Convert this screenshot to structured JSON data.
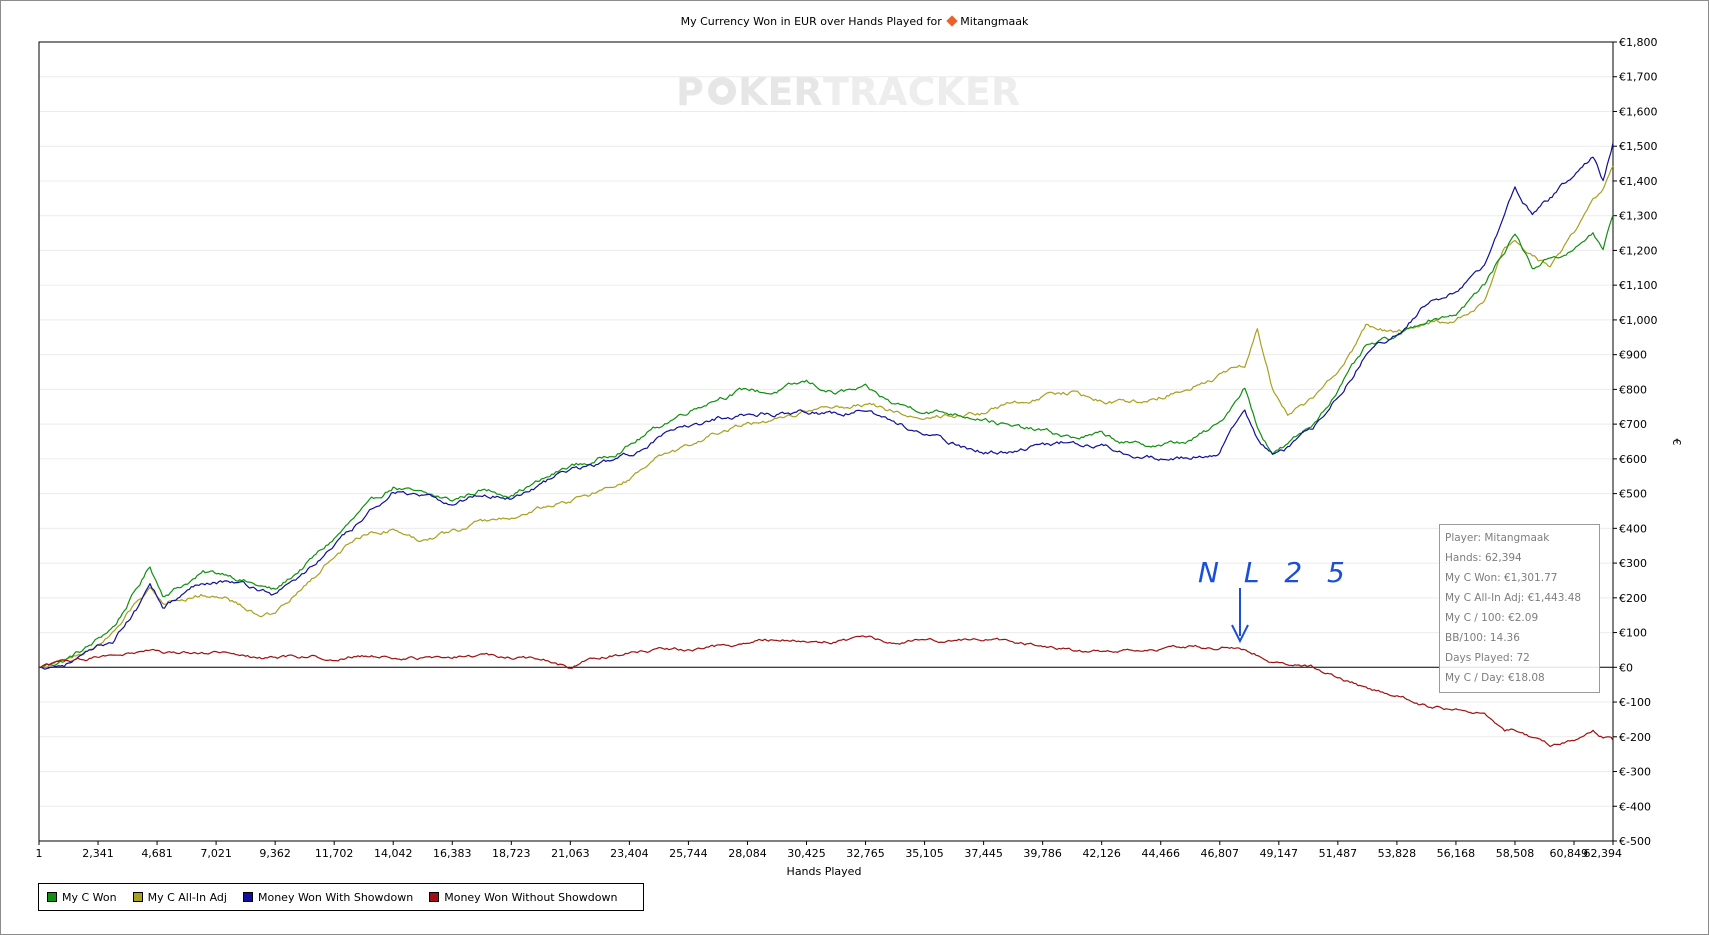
{
  "title": {
    "prefix": "My Currency Won in EUR over Hands Played for",
    "player": "Mitangmaak"
  },
  "watermark": {
    "part1": "P",
    "part2": "KER",
    "part3": "TRACKER"
  },
  "colors": {
    "my_c_won": "#109010",
    "all_in_adj": "#a8a020",
    "showdown": "#10109a",
    "non_showdown": "#a01010",
    "annotation": "#1b4fd8"
  },
  "annotation": {
    "text": "N L 2 5"
  },
  "tooltip": {
    "player": "Player: Mitangmaak",
    "hands": "Hands: 62,394",
    "my_c_won": "My C Won: €1,301.77",
    "all_in_adj": "My C All-In Adj: €1,443.48",
    "per100": "My C / 100: €2.09",
    "bb100": "BB/100: 14.36",
    "days": "Days Played: 72",
    "per_day": "My C / Day: €18.08"
  },
  "chart_data": {
    "type": "line",
    "title": "My Currency Won in EUR over Hands Played for Mitangmaak",
    "xlabel": "Hands Played",
    "ylabel": "€",
    "xlim": [
      1,
      62394
    ],
    "ylim": [
      -500,
      1800
    ],
    "x_ticks": [
      "1",
      "2,341",
      "4,681",
      "7,021",
      "9,362",
      "11,702",
      "14,042",
      "16,383",
      "18,723",
      "21,063",
      "23,404",
      "25,744",
      "28,084",
      "30,425",
      "32,765",
      "35,105",
      "37,445",
      "39,786",
      "42,126",
      "44,466",
      "46,807",
      "49,147",
      "51,487",
      "53,828",
      "56,168",
      "58,508",
      "60,849",
      "62,394"
    ],
    "y_ticks": [
      "€1,800",
      "€1,700",
      "€1,600",
      "€1,500",
      "€1,400",
      "€1,300",
      "€1,200",
      "€1,100",
      "€1,000",
      "€900",
      "€800",
      "€700",
      "€600",
      "€500",
      "€400",
      "€300",
      "€200",
      "€100",
      "€0",
      "€-100",
      "€-200",
      "€-300",
      "€-400",
      "€-500"
    ],
    "grid": true,
    "legend_position": "bottom-left",
    "series": [
      {
        "name": "My C Won",
        "x": [
          1,
          1000,
          2000,
          3000,
          4000,
          4400,
          4900,
          5500,
          6500,
          7500,
          8500,
          9362,
          10500,
          11702,
          12800,
          14042,
          15000,
          16383,
          17500,
          18723,
          20000,
          21063,
          22000,
          23404,
          24500,
          25744,
          27000,
          28084,
          29000,
          30425,
          31500,
          32765,
          33800,
          35105,
          36300,
          37445,
          38600,
          39786,
          41000,
          42126,
          43300,
          44466,
          45600,
          46807,
          47800,
          48300,
          48900,
          49500,
          50500,
          51487,
          52600,
          53828,
          55000,
          56168,
          57300,
          58100,
          58508,
          59200,
          59900,
          60849,
          61600,
          62000,
          62394
        ],
        "values": [
          0,
          20,
          60,
          120,
          240,
          290,
          210,
          230,
          270,
          270,
          240,
          220,
          290,
          370,
          450,
          520,
          500,
          480,
          510,
          500,
          540,
          580,
          590,
          640,
          690,
          740,
          780,
          800,
          790,
          820,
          790,
          800,
          760,
          740,
          730,
          720,
          690,
          680,
          660,
          670,
          640,
          640,
          650,
          700,
          810,
          690,
          620,
          640,
          700,
          800,
          920,
          950,
          1000,
          1020,
          1100,
          1200,
          1250,
          1150,
          1180,
          1200,
          1250,
          1200,
          1302
        ]
      },
      {
        "name": "My C All-In Adj",
        "x": [
          1,
          1000,
          2000,
          3000,
          4000,
          4400,
          4900,
          5500,
          6500,
          7500,
          8500,
          9362,
          10500,
          11702,
          12800,
          14042,
          15000,
          16383,
          17500,
          18723,
          20000,
          21063,
          22000,
          23404,
          24500,
          25744,
          27000,
          28084,
          29000,
          30425,
          31500,
          32765,
          33800,
          35105,
          36300,
          37445,
          38600,
          39786,
          41000,
          42126,
          43300,
          44466,
          45600,
          46807,
          47800,
          48300,
          48900,
          49500,
          50500,
          51487,
          52600,
          53828,
          55000,
          56168,
          57300,
          58100,
          58508,
          59200,
          59900,
          60849,
          61600,
          62000,
          62394
        ],
        "values": [
          0,
          20,
          50,
          100,
          200,
          230,
          190,
          200,
          210,
          200,
          160,
          150,
          230,
          320,
          380,
          400,
          370,
          390,
          420,
          430,
          460,
          480,
          500,
          540,
          600,
          630,
          680,
          700,
          700,
          740,
          750,
          760,
          740,
          720,
          730,
          730,
          760,
          780,
          790,
          770,
          760,
          780,
          810,
          840,
          870,
          980,
          800,
          730,
          770,
          850,
          980,
          960,
          990,
          1000,
          1050,
          1200,
          1230,
          1180,
          1150,
          1250,
          1350,
          1380,
          1443
        ]
      },
      {
        "name": "Money Won With Showdown",
        "x": [
          1,
          1000,
          2000,
          3000,
          4000,
          4400,
          4900,
          5500,
          6500,
          7500,
          8500,
          9362,
          10500,
          11702,
          12800,
          14042,
          15000,
          16383,
          17500,
          18723,
          20000,
          21063,
          22000,
          23404,
          24500,
          25744,
          27000,
          28084,
          29000,
          30425,
          31500,
          32765,
          33800,
          35105,
          36300,
          37445,
          38600,
          39786,
          41000,
          42126,
          43300,
          44466,
          45600,
          46807,
          47800,
          48300,
          48900,
          49500,
          50500,
          51487,
          52600,
          53828,
          55000,
          56168,
          57300,
          58100,
          58508,
          59200,
          59900,
          60849,
          61600,
          62000,
          62394
        ],
        "values": [
          0,
          10,
          40,
          80,
          180,
          250,
          180,
          200,
          250,
          250,
          230,
          210,
          270,
          350,
          420,
          510,
          490,
          470,
          500,
          490,
          530,
          570,
          580,
          610,
          660,
          690,
          720,
          730,
          730,
          740,
          730,
          740,
          710,
          670,
          640,
          620,
          620,
          640,
          650,
          640,
          620,
          600,
          600,
          620,
          740,
          660,
          610,
          630,
          690,
          780,
          900,
          960,
          1050,
          1080,
          1150,
          1300,
          1380,
          1300,
          1350,
          1420,
          1470,
          1400,
          1510
        ]
      },
      {
        "name": "Money Won Without Showdown",
        "x": [
          1,
          1000,
          2000,
          3000,
          4000,
          4681,
          5500,
          7021,
          8500,
          9362,
          10500,
          11702,
          12800,
          14042,
          15000,
          16383,
          17500,
          18723,
          20000,
          21063,
          22000,
          23404,
          24500,
          25744,
          27000,
          28084,
          29000,
          30425,
          31500,
          32765,
          33800,
          35105,
          36300,
          37445,
          38600,
          39786,
          41000,
          42126,
          43300,
          44466,
          45600,
          46807,
          47500,
          48000,
          48500,
          49147,
          50500,
          51487,
          52600,
          53828,
          55000,
          56168,
          57300,
          58100,
          58508,
          59200,
          59900,
          60849,
          61600,
          62000,
          62394
        ],
        "values": [
          0,
          15,
          25,
          40,
          40,
          50,
          40,
          40,
          30,
          25,
          30,
          25,
          35,
          30,
          25,
          30,
          35,
          30,
          20,
          0,
          30,
          40,
          50,
          50,
          60,
          70,
          80,
          80,
          75,
          85,
          70,
          80,
          75,
          85,
          70,
          60,
          50,
          45,
          55,
          55,
          60,
          55,
          60,
          40,
          30,
          10,
          0,
          -30,
          -60,
          -80,
          -110,
          -120,
          -130,
          -180,
          -180,
          -200,
          -220,
          -210,
          -180,
          -200,
          -210
        ]
      }
    ]
  },
  "legend": {
    "items": [
      {
        "label": "My C Won",
        "color": "#109010"
      },
      {
        "label": "My C All-In Adj",
        "color": "#a8a020"
      },
      {
        "label": "Money Won With Showdown",
        "color": "#10109a"
      },
      {
        "label": "Money Won Without Showdown",
        "color": "#a01010"
      }
    ]
  }
}
